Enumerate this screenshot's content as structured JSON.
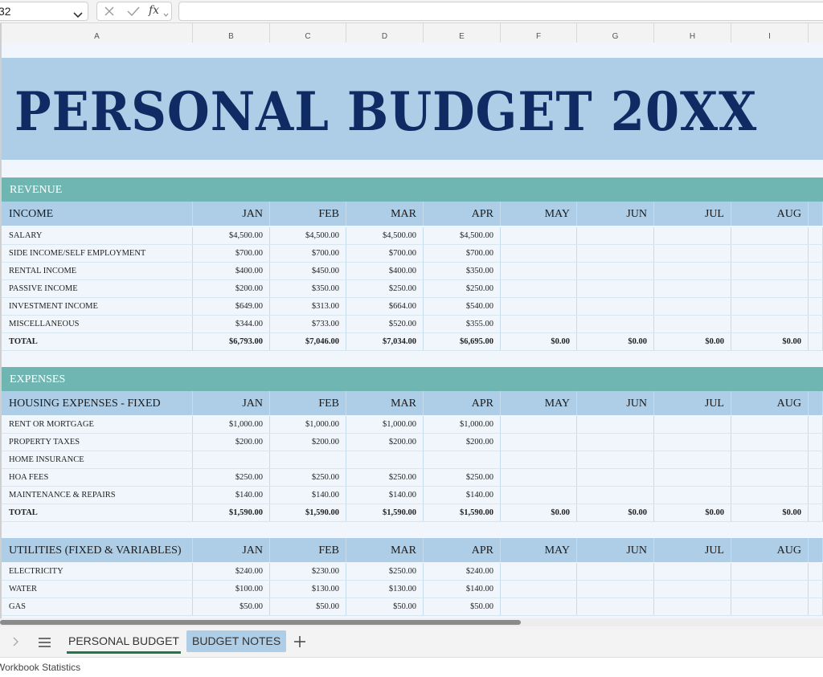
{
  "formula_bar": {
    "name_box": "32",
    "fx_label": "fx",
    "formula": ""
  },
  "columns": [
    "A",
    "B",
    "C",
    "D",
    "E",
    "F",
    "G",
    "H",
    "I"
  ],
  "title": "PERSONAL BUDGET 20XX",
  "months": [
    "JAN",
    "FEB",
    "MAR",
    "APR",
    "MAY",
    "JUN",
    "JUL",
    "AUG"
  ],
  "revenue": {
    "section": "REVENUE",
    "header": "INCOME",
    "rows": [
      {
        "label": "SALARY",
        "values": [
          "$4,500.00",
          "$4,500.00",
          "$4,500.00",
          "$4,500.00",
          "",
          "",
          "",
          ""
        ]
      },
      {
        "label": "SIDE INCOME/SELF EMPLOYMENT",
        "values": [
          "$700.00",
          "$700.00",
          "$700.00",
          "$700.00",
          "",
          "",
          "",
          ""
        ]
      },
      {
        "label": "RENTAL INCOME",
        "values": [
          "$400.00",
          "$450.00",
          "$400.00",
          "$350.00",
          "",
          "",
          "",
          ""
        ]
      },
      {
        "label": "PASSIVE INCOME",
        "values": [
          "$200.00",
          "$350.00",
          "$250.00",
          "$250.00",
          "",
          "",
          "",
          ""
        ]
      },
      {
        "label": "INVESTMENT INCOME",
        "values": [
          "$649.00",
          "$313.00",
          "$664.00",
          "$540.00",
          "",
          "",
          "",
          ""
        ]
      },
      {
        "label": "MISCELLANEOUS",
        "values": [
          "$344.00",
          "$733.00",
          "$520.00",
          "$355.00",
          "",
          "",
          "",
          ""
        ]
      },
      {
        "label": "TOTAL",
        "total": true,
        "values": [
          "$6,793.00",
          "$7,046.00",
          "$7,034.00",
          "$6,695.00",
          "$0.00",
          "$0.00",
          "$0.00",
          "$0.00"
        ]
      }
    ]
  },
  "expenses": {
    "section": "EXPENSES",
    "housing": {
      "header": "HOUSING EXPENSES - FIXED",
      "rows": [
        {
          "label": "RENT OR MORTGAGE",
          "values": [
            "$1,000.00",
            "$1,000.00",
            "$1,000.00",
            "$1,000.00",
            "",
            "",
            "",
            ""
          ]
        },
        {
          "label": "PROPERTY TAXES",
          "values": [
            "$200.00",
            "$200.00",
            "$200.00",
            "$200.00",
            "",
            "",
            "",
            ""
          ]
        },
        {
          "label": "HOME INSURANCE",
          "values": [
            "",
            "",
            "",
            "",
            "",
            "",
            "",
            ""
          ]
        },
        {
          "label": "HOA FEES",
          "values": [
            "$250.00",
            "$250.00",
            "$250.00",
            "$250.00",
            "",
            "",
            "",
            ""
          ]
        },
        {
          "label": "MAINTENANCE & REPAIRS",
          "values": [
            "$140.00",
            "$140.00",
            "$140.00",
            "$140.00",
            "",
            "",
            "",
            ""
          ]
        },
        {
          "label": "TOTAL",
          "total": true,
          "values": [
            "$1,590.00",
            "$1,590.00",
            "$1,590.00",
            "$1,590.00",
            "$0.00",
            "$0.00",
            "$0.00",
            "$0.00"
          ]
        }
      ]
    },
    "utilities": {
      "header": "UTILITIES (FIXED & VARIABLES)",
      "rows": [
        {
          "label": "ELECTRICITY",
          "values": [
            "$240.00",
            "$230.00",
            "$250.00",
            "$240.00",
            "",
            "",
            "",
            ""
          ]
        },
        {
          "label": "WATER",
          "values": [
            "$100.00",
            "$130.00",
            "$130.00",
            "$140.00",
            "",
            "",
            "",
            ""
          ]
        },
        {
          "label": "GAS",
          "values": [
            "$50.00",
            "$50.00",
            "$50.00",
            "$50.00",
            "",
            "",
            "",
            ""
          ]
        }
      ]
    }
  },
  "tabs": [
    "PERSONAL BUDGET",
    "BUDGET NOTES"
  ],
  "status": "Workbook Statistics",
  "colors": {
    "title_band": "#aecde6",
    "title_text": "#0f2b63",
    "section": "#6fb6b2",
    "sheet_bg": "#f0f6fb",
    "active_tab_underline": "#1e7a45"
  }
}
